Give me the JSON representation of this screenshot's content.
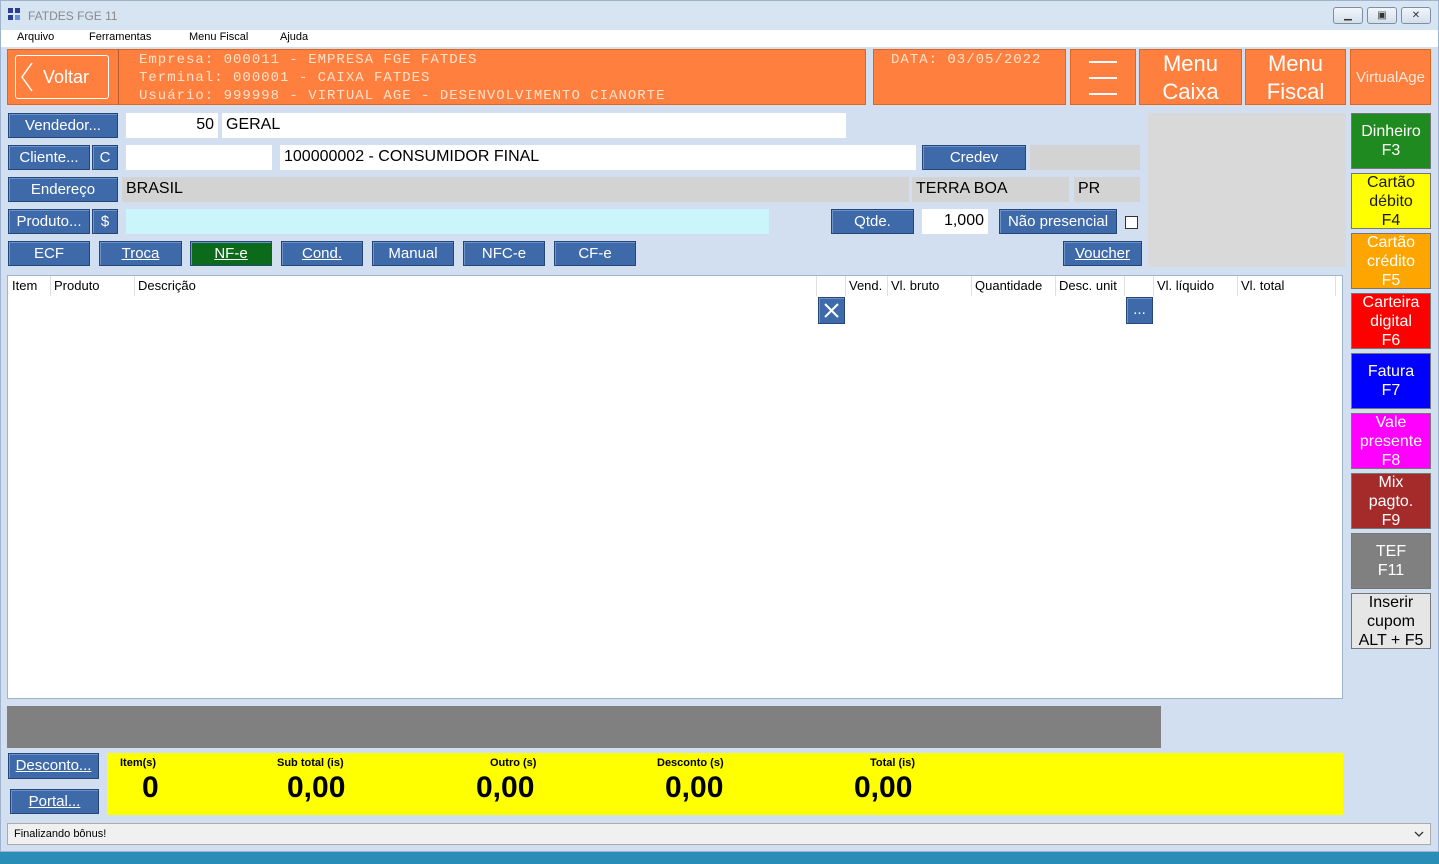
{
  "window": {
    "title": "FATDES FGE 11"
  },
  "menu": [
    "Arquivo",
    "Ferramentas",
    "Menu Fiscal",
    "Ajuda"
  ],
  "header": {
    "back_label": "Voltar",
    "empresa": "Empresa: 000011 - EMPRESA FGE FATDES",
    "terminal": "Terminal: 000001 - CAIXA FATDES",
    "usuario": "Usuário: 999998 - VIRTUAL AGE - DESENVOLVIMENTO CIANORTE",
    "data": "DATA: 03/05/2022",
    "menu_caixa": [
      "Menu",
      "Caixa"
    ],
    "menu_fiscal": [
      "Menu",
      "Fiscal"
    ],
    "brand": "VirtualAge"
  },
  "form": {
    "vendedor_btn": "Vendedor...",
    "vendedor_code": "50",
    "vendedor_name": "GERAL",
    "cliente_btn": "Cliente...",
    "c_btn": "C",
    "cliente_code": "",
    "cliente_name": "100000002 - CONSUMIDOR FINAL",
    "credev_btn": "Credev",
    "endereco_btn": "Endereço",
    "endereco": "BRASIL",
    "cidade": "TERRA BOA",
    "uf": "PR",
    "produto_btn": "Produto...",
    "price_btn": "$",
    "produto_value": "",
    "qtde_btn": "Qtde.",
    "qtde_value": "1,000",
    "nao_presencial": "Não presencial"
  },
  "doc_buttons": [
    "ECF",
    "Troca",
    "NF-e",
    "Cond.",
    "Manual",
    "NFC-e",
    "CF-e"
  ],
  "voucher_btn": "Voucher",
  "grid": {
    "columns": [
      "Item",
      "Produto",
      "Descrição",
      "Vend.",
      "Vl. bruto",
      "Quantidade",
      "Desc. unit",
      "Vl. líquido",
      "Vl. total"
    ],
    "more_btn": "...",
    "rows": []
  },
  "payments": [
    {
      "lines": [
        "Dinheiro",
        "F3"
      ],
      "bg": "#1f8a1f",
      "fg": "#ffffff"
    },
    {
      "lines": [
        "Cartão",
        "débito",
        "F4"
      ],
      "bg": "#ffff00",
      "fg": "#1a1a1a"
    },
    {
      "lines": [
        "Cartão",
        "crédito",
        "F5"
      ],
      "bg": "#ffa500",
      "fg": "#ffffff"
    },
    {
      "lines": [
        "Carteira",
        "digital",
        "F6"
      ],
      "bg": "#ff0000",
      "fg": "#ffffff"
    },
    {
      "lines": [
        "Fatura",
        "F7"
      ],
      "bg": "#0000ff",
      "fg": "#ffffff"
    },
    {
      "lines": [
        "Vale",
        "presente",
        "F8"
      ],
      "bg": "#ff00ff",
      "fg": "#ffffff"
    },
    {
      "lines": [
        "Mix",
        "pagto.",
        "F9"
      ],
      "bg": "#a52a2a",
      "fg": "#ffffff"
    },
    {
      "lines": [
        "TEF",
        "F11"
      ],
      "bg": "#808080",
      "fg": "#ffffff"
    },
    {
      "lines": [
        "Inserir",
        "cupom",
        "ALT + F5"
      ],
      "bg": "#e6e6e6",
      "fg": "#000000"
    }
  ],
  "footer": {
    "desconto_btn": "Desconto...",
    "portal_btn": "Portal...",
    "totals": [
      {
        "label": "Item(s)",
        "value": "0"
      },
      {
        "label": "Sub total (is)",
        "value": "0,00"
      },
      {
        "label": "Outro (s)",
        "value": "0,00"
      },
      {
        "label": "Desconto (s)",
        "value": "0,00"
      },
      {
        "label": "Total (is)",
        "value": "0,00"
      }
    ],
    "status": "Finalizando bônus!"
  }
}
